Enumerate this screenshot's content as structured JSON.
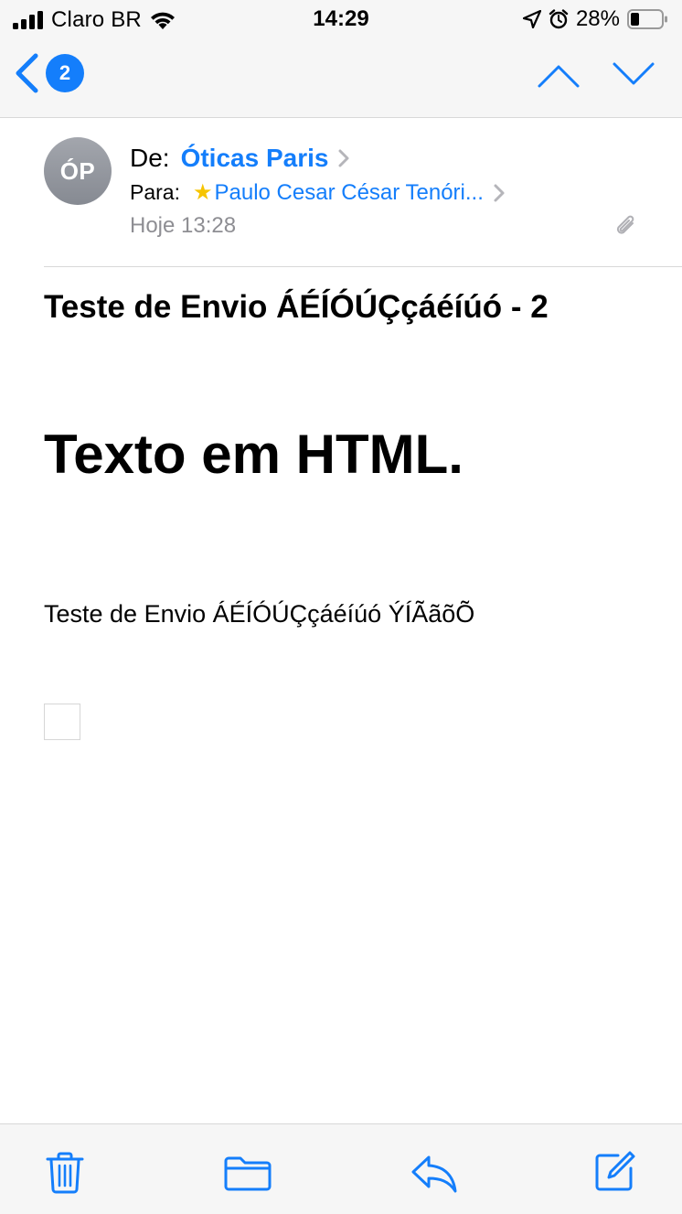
{
  "status_bar": {
    "carrier": "Claro BR",
    "time": "14:29",
    "battery_percent": "28%"
  },
  "nav": {
    "unread_badge": "2"
  },
  "message": {
    "avatar_initials": "ÓP",
    "from_label": "De:",
    "from_name": "Óticas Paris",
    "to_label": "Para:",
    "to_name": "Paulo Cesar César Tenóri...",
    "date": "Hoje 13:28",
    "subject": "Teste de Envio ÁÉÍÓÚÇçáéíúó - 2",
    "body_heading": "Texto em HTML.",
    "body_text": "Teste de Envio ÁÉÍÓÚÇçáéíúó ÝÍÃãõÕ"
  },
  "colors": {
    "accent": "#147efb",
    "star": "#f6c400",
    "secondary_text": "#8e8e93"
  }
}
